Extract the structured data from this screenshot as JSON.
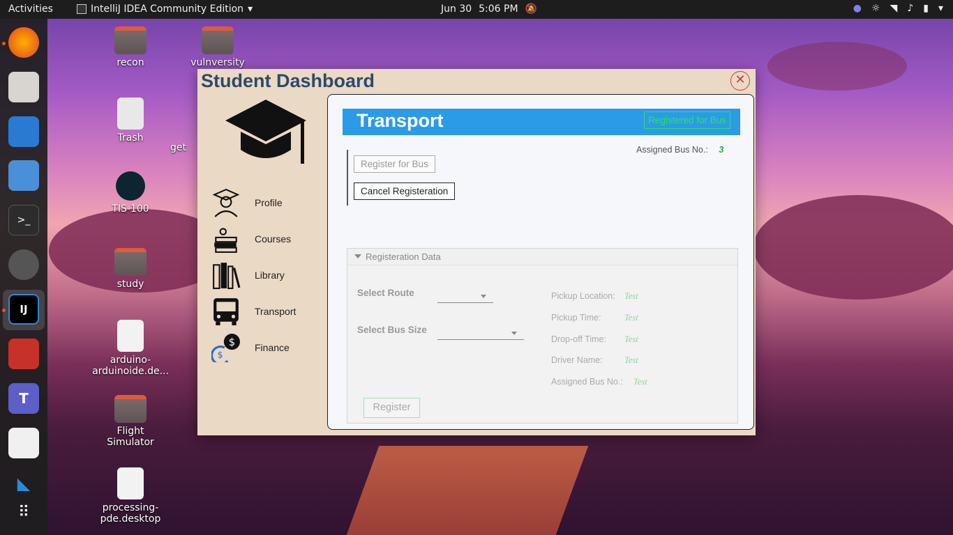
{
  "topbar": {
    "activities": "Activities",
    "app_name": "IntelliJ IDEA Community Edition",
    "date": "Jun 30",
    "time": "5:06 PM"
  },
  "desktop": {
    "icons": [
      {
        "label": "recon"
      },
      {
        "label": "vulnversity"
      },
      {
        "label": "Trash"
      },
      {
        "label": "get"
      },
      {
        "label": "TIS-100"
      },
      {
        "label": "study"
      },
      {
        "label": "arduino-arduinoide.de..."
      },
      {
        "label": "Flight Simulator"
      },
      {
        "label": "processing-pde.desktop"
      }
    ]
  },
  "window": {
    "title": "Student Dashboard",
    "close_glyph": "✕",
    "nav": [
      {
        "label": "Profile",
        "icon": "student-icon"
      },
      {
        "label": "Courses",
        "icon": "books-stack-icon"
      },
      {
        "label": "Library",
        "icon": "bookshelf-icon"
      },
      {
        "label": "Transport",
        "icon": "bus-icon"
      },
      {
        "label": "Finance",
        "icon": "finance-icon"
      }
    ]
  },
  "transport": {
    "title": "Transport",
    "status": "Registered for Bus",
    "assigned_label": "Assigned Bus No.:",
    "assigned_value": "3",
    "register_button": "Register for Bus",
    "cancel_button": "Cancel Registeration",
    "section_title": "Registeration Data",
    "select_route_label": "Select Route",
    "select_bus_size_label": "Select Bus Size",
    "info": {
      "pickup_location_label": "Pickup Location:",
      "pickup_location_value": "Test",
      "pickup_time_label": "Pickup Time:",
      "pickup_time_value": "Test",
      "dropoff_time_label": "Drop-off Time:",
      "dropoff_time_value": "Test",
      "driver_name_label": "Driver Name:",
      "driver_name_value": "Test",
      "assigned_bus_label": "Assigned Bus No.:",
      "assigned_bus_value": "Test"
    },
    "submit_button": "Register"
  },
  "colors": {
    "banner": "#2b9be8",
    "status_green": "#2de06a",
    "window_bg": "#ead9c5",
    "title_color": "#2f4a68"
  }
}
